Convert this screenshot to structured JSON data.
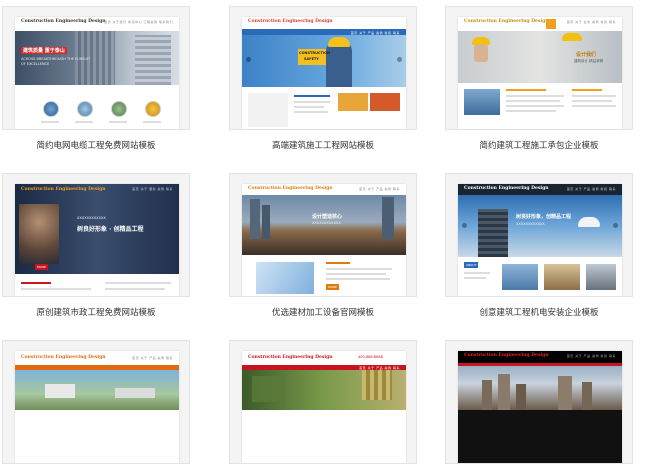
{
  "templates": [
    {
      "caption": "简约电网电缆工程免费网站模板",
      "logo": "Construction Engineering Design",
      "nav": "首页  关于我们  新闻中心  工程案例  联系我们",
      "hero_line1": "建筑质量 重于泰山",
      "hero_line2": "ACROSS BREAKTHROUGH THE PURSUIT",
      "hero_line3": "OF EXCELLENCE"
    },
    {
      "caption": "高端建筑施工工程网站模板",
      "logo": "Construction Engineering Design",
      "nav": "首页  关于  产品  案例  新闻  联系",
      "hero_line1": "CONSTRUCTION",
      "hero_line2": "SAFETY"
    },
    {
      "caption": "简约建筑工程施工承包企业模板",
      "logo": "Construction Engineering Design",
      "nav": "首页  关于  业务  案例  新闻  联系",
      "hero_line1": "设计我们",
      "hero_line2": "建筑设计 精益求精"
    },
    {
      "caption": "原创建筑市政工程免费网站模板",
      "logo": "Construction Engineering Design",
      "nav": "首页  关于  服务  案例  联系",
      "hero_line1": "树良好形象 · 创精品工程",
      "hero_line2": "XXXXXXXXXXXX"
    },
    {
      "caption": "优选建材加工设备官网模板",
      "logo": "Construction Engineering Design",
      "nav": "首页  关于  产品  案例  联系",
      "hero_line1": "设计塑造核心",
      "hero_line2": "XXXXXXXXXXXX"
    },
    {
      "caption": "创意建筑工程机电安装企业模板",
      "logo": "Construction Engineering Design",
      "nav": "首页  关于  产品  案例  新闻  联系",
      "hero_line1": "树良好形象，创精品工程",
      "hero_line2": "XXXXXXXXXXXX"
    },
    {
      "caption": "",
      "logo": "Construction Engineering Design",
      "nav": "首页  关于  产品  案例  联系"
    },
    {
      "caption": "",
      "logo": "Construction Engineering Design",
      "nav": "首页  关于  产品  案例  联系",
      "phone": "400-888-8888"
    },
    {
      "caption": "",
      "logo": "Construction Engineering Design",
      "nav": "首页  关于  产品  案例  新闻  联系"
    }
  ],
  "colors": {
    "orange": "#f0a020",
    "blue": "#2a6ab8",
    "red": "#c8141e",
    "dark": "#222222"
  }
}
